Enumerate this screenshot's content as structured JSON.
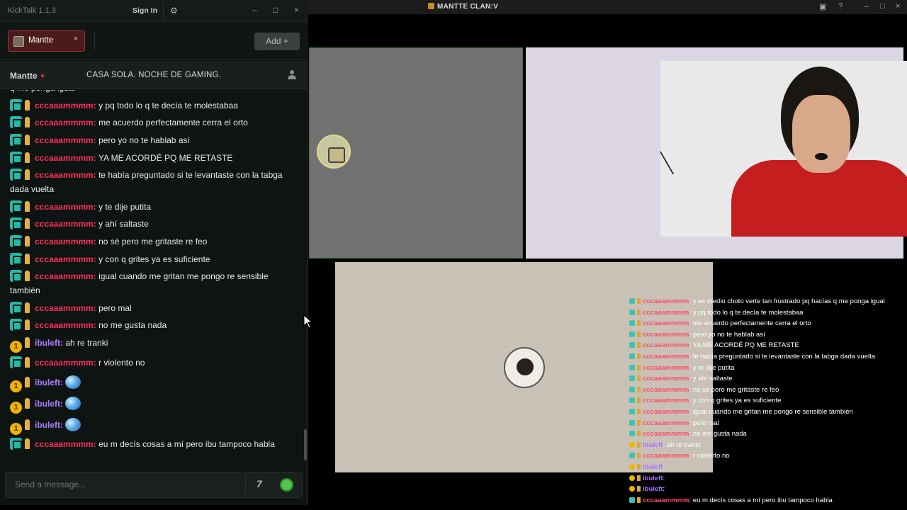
{
  "obs": {
    "window_title": "MANTTE CLAN:V"
  },
  "kicktalk": {
    "app_title": "KickTalk 1.1.3",
    "sign_in": "Sign In",
    "tab": {
      "channel": "Mantte",
      "close": "×"
    },
    "add_label": "Add +",
    "header": {
      "channel": "Mantte",
      "stream_title": "CASA SOLA. NOCHE DE GAMING."
    },
    "input_placeholder": "Send a message...",
    "messages": [
      {
        "badge": "sub",
        "user": "",
        "text": "q me ponga igual",
        "cont": true
      },
      {
        "badge": "sub",
        "user": "cccaaammmm:",
        "text": "y pq todo lo q te decía te molestabaa"
      },
      {
        "badge": "sub",
        "user": "cccaaammmm:",
        "text": "me acuerdo perfectamente cerra el orto"
      },
      {
        "badge": "sub",
        "user": "cccaaammmm:",
        "text": "pero yo no te hablab así"
      },
      {
        "badge": "sub",
        "user": "cccaaammmm:",
        "text": "YA ME ACORDÉ PQ ME RETASTE"
      },
      {
        "badge": "sub",
        "user": "cccaaammmm:",
        "text": "te había preguntado si te levantaste con la tabga dada vuelta"
      },
      {
        "badge": "sub",
        "user": "cccaaammmm:",
        "text": "y te dije putita"
      },
      {
        "badge": "sub",
        "user": "cccaaammmm:",
        "text": "y ahí saltaste"
      },
      {
        "badge": "sub",
        "user": "cccaaammmm:",
        "text": "no sé pero me gritaste re feo"
      },
      {
        "badge": "sub",
        "user": "cccaaammmm:",
        "text": "y con q grites ya es suficiente"
      },
      {
        "badge": "sub",
        "user": "cccaaammmm:",
        "text": "igual cuando me gritan me pongo re sensible también"
      },
      {
        "badge": "sub",
        "user": "cccaaammmm:",
        "text": "pero mal"
      },
      {
        "badge": "sub",
        "user": "cccaaammmm:",
        "text": "no me gusta nada"
      },
      {
        "badge": "one",
        "user": "ibuleft:",
        "text": "ah re tranki"
      },
      {
        "badge": "sub",
        "user": "cccaaammmm:",
        "text": "r violento no"
      },
      {
        "badge": "one",
        "user": "ibuleft:",
        "text": "",
        "emote": "globe-emote"
      },
      {
        "badge": "one",
        "user": "ibuleft:",
        "text": "",
        "emote": "globe-emote"
      },
      {
        "badge": "one",
        "user": "ibuleft:",
        "text": "",
        "emote": "globe-emote"
      },
      {
        "badge": "sub",
        "user": "cccaaammmm:",
        "text": "eu m decís cosas a mí pero ibu tampoco habla"
      }
    ]
  },
  "overlay": {
    "lines": [
      {
        "user": "cccaaammmm",
        "text": "y es medio choto verte tan frustrado pq hacías q me ponga igual",
        "badge": "sub"
      },
      {
        "user": "cccaaammmm",
        "text": "y pq todo lo q te decía te molestabaa",
        "badge": "sub"
      },
      {
        "user": "cccaaammmm",
        "text": "me acuerdo perfectamente cerra el orto",
        "badge": "sub"
      },
      {
        "user": "cccaaammmm",
        "text": "pero yo no te hablab así",
        "badge": "sub"
      },
      {
        "user": "cccaaammmm",
        "text": "YA ME ACORDÉ PQ ME RETASTE",
        "badge": "sub"
      },
      {
        "user": "cccaaammmm",
        "text": "te había preguntado si te levantaste con la tabga dada vuelta",
        "badge": "sub"
      },
      {
        "user": "cccaaammmm",
        "text": "y te dije putita",
        "badge": "sub"
      },
      {
        "user": "cccaaammmm",
        "text": "y ahí saltaste",
        "badge": "sub"
      },
      {
        "user": "cccaaammmm",
        "text": "no sé pero me gritaste re feo",
        "badge": "sub"
      },
      {
        "user": "cccaaammmm",
        "text": "y con q grites ya es suficiente",
        "badge": "sub"
      },
      {
        "user": "cccaaammmm",
        "text": "igual cuando me gritan me pongo re sensible también",
        "badge": "sub"
      },
      {
        "user": "cccaaammmm",
        "text": "pero mal",
        "badge": "sub"
      },
      {
        "user": "cccaaammmm",
        "text": "no me gusta nada",
        "badge": "sub"
      },
      {
        "user": "ibuleft",
        "text": "ah re tranki",
        "badge": "one"
      },
      {
        "user": "cccaaammmm",
        "text": "r violento no",
        "badge": "sub"
      },
      {
        "user": "ibuleft",
        "text": "",
        "badge": "one"
      },
      {
        "user": "ibuleft",
        "text": "",
        "badge": "one"
      },
      {
        "user": "ibuleft",
        "text": "",
        "badge": "one"
      },
      {
        "user": "cccaaammmm",
        "text": "eu m decís cosas a mí pero ibu tampoco habla",
        "badge": "sub"
      }
    ]
  },
  "colors": {
    "sub_name": "#ff2e5a",
    "vip_name": "#b07cff",
    "tab_accent": "#a53030"
  }
}
